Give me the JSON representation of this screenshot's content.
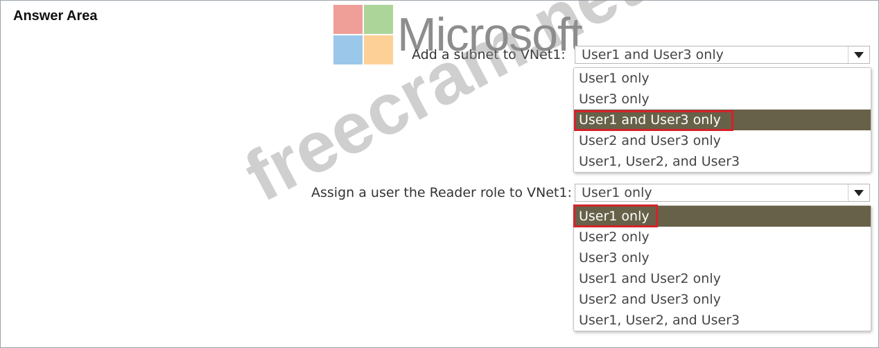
{
  "header": {
    "title": "Answer Area"
  },
  "logo": {
    "text": "Microsoft"
  },
  "watermark": {
    "text": "freecram.net"
  },
  "question1": {
    "label": "Add a subnet to VNet1:",
    "selected": "User1 and User3 only",
    "options": [
      "User1 only",
      "User3 only",
      "User1 and User3 only",
      "User2 and User3 only",
      "User1, User2, and User3"
    ],
    "highlighted_index": 2
  },
  "question2": {
    "label": "Assign a user the Reader role to VNet1:",
    "selected": "User1 only",
    "options": [
      "User1 only",
      "User2 only",
      "User3 only",
      "User1 and User2 only",
      "User2 and User3 only",
      "User1, User2, and User3"
    ],
    "highlighted_index": 0
  },
  "colors": {
    "selected_row": "#666148",
    "highlight_border": "#d5222b"
  }
}
